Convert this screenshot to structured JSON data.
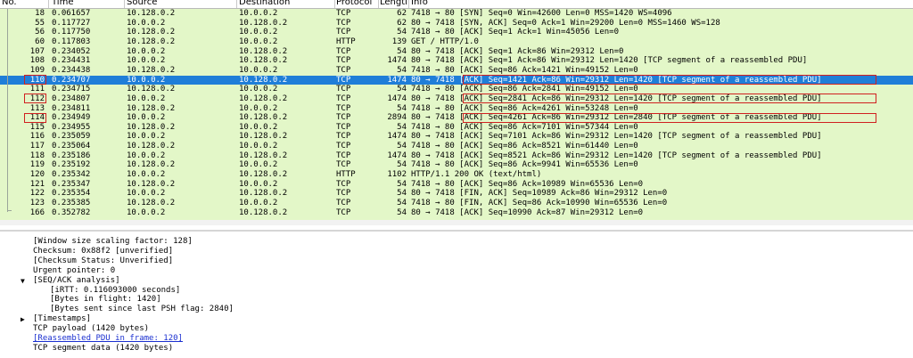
{
  "columns": [
    "No.",
    "Time",
    "Source",
    "Destination",
    "Protocol",
    "Lengtl",
    "Info"
  ],
  "packets": [
    {
      "no": "18",
      "time": "0.061657",
      "src": "10.128.0.2",
      "dst": "10.0.0.2",
      "proto": "TCP",
      "len": "62",
      "info": "7418 → 80 [SYN] Seq=0 Win=42600 Len=0 MSS=1420 WS=4096"
    },
    {
      "no": "55",
      "time": "0.117727",
      "src": "10.0.0.2",
      "dst": "10.128.0.2",
      "proto": "TCP",
      "len": "62",
      "info": "80 → 7418 [SYN, ACK] Seq=0 Ack=1 Win=29200 Len=0 MSS=1460 WS=128"
    },
    {
      "no": "56",
      "time": "0.117750",
      "src": "10.128.0.2",
      "dst": "10.0.0.2",
      "proto": "TCP",
      "len": "54",
      "info": "7418 → 80 [ACK] Seq=1 Ack=1 Win=45056 Len=0"
    },
    {
      "no": "60",
      "time": "0.117803",
      "src": "10.128.0.2",
      "dst": "10.0.0.2",
      "proto": "HTTP",
      "len": "139",
      "info": "GET / HTTP/1.0"
    },
    {
      "no": "107",
      "time": "0.234052",
      "src": "10.0.0.2",
      "dst": "10.128.0.2",
      "proto": "TCP",
      "len": "54",
      "info": "80 → 7418 [ACK] Seq=1 Ack=86 Win=29312 Len=0"
    },
    {
      "no": "108",
      "time": "0.234431",
      "src": "10.0.0.2",
      "dst": "10.128.0.2",
      "proto": "TCP",
      "len": "1474",
      "info": "80 → 7418 [ACK] Seq=1 Ack=86 Win=29312 Len=1420 [TCP segment of a reassembled PDU]"
    },
    {
      "no": "109",
      "time": "0.234438",
      "src": "10.128.0.2",
      "dst": "10.0.0.2",
      "proto": "TCP",
      "len": "54",
      "info": "7418 → 80 [ACK] Seq=86 Ack=1421 Win=49152 Len=0"
    },
    {
      "no": "110",
      "time": "0.234707",
      "src": "10.0.0.2",
      "dst": "10.128.0.2",
      "proto": "TCP",
      "len": "1474",
      "info": "80 → 7418 [ACK] Seq=1421 Ack=86 Win=29312 Len=1420 [TCP segment of a reassembled PDU]"
    },
    {
      "no": "111",
      "time": "0.234715",
      "src": "10.128.0.2",
      "dst": "10.0.0.2",
      "proto": "TCP",
      "len": "54",
      "info": "7418 → 80 [ACK] Seq=86 Ack=2841 Win=49152 Len=0"
    },
    {
      "no": "112",
      "time": "0.234807",
      "src": "10.0.0.2",
      "dst": "10.128.0.2",
      "proto": "TCP",
      "len": "1474",
      "info": "80 → 7418 [ACK] Seq=2841 Ack=86 Win=29312 Len=1420 [TCP segment of a reassembled PDU]"
    },
    {
      "no": "113",
      "time": "0.234811",
      "src": "10.128.0.2",
      "dst": "10.0.0.2",
      "proto": "TCP",
      "len": "54",
      "info": "7418 → 80 [ACK] Seq=86 Ack=4261 Win=53248 Len=0"
    },
    {
      "no": "114",
      "time": "0.234949",
      "src": "10.0.0.2",
      "dst": "10.128.0.2",
      "proto": "TCP",
      "len": "2894",
      "info": "80 → 7418 [ACK] Seq=4261 Ack=86 Win=29312 Len=2840 [TCP segment of a reassembled PDU]"
    },
    {
      "no": "115",
      "time": "0.234955",
      "src": "10.128.0.2",
      "dst": "10.0.0.2",
      "proto": "TCP",
      "len": "54",
      "info": "7418 → 80 [ACK] Seq=86 Ack=7101 Win=57344 Len=0"
    },
    {
      "no": "116",
      "time": "0.235059",
      "src": "10.0.0.2",
      "dst": "10.128.0.2",
      "proto": "TCP",
      "len": "1474",
      "info": "80 → 7418 [ACK] Seq=7101 Ack=86 Win=29312 Len=1420 [TCP segment of a reassembled PDU]"
    },
    {
      "no": "117",
      "time": "0.235064",
      "src": "10.128.0.2",
      "dst": "10.0.0.2",
      "proto": "TCP",
      "len": "54",
      "info": "7418 → 80 [ACK] Seq=86 Ack=8521 Win=61440 Len=0"
    },
    {
      "no": "118",
      "time": "0.235186",
      "src": "10.0.0.2",
      "dst": "10.128.0.2",
      "proto": "TCP",
      "len": "1474",
      "info": "80 → 7418 [ACK] Seq=8521 Ack=86 Win=29312 Len=1420 [TCP segment of a reassembled PDU]"
    },
    {
      "no": "119",
      "time": "0.235192",
      "src": "10.128.0.2",
      "dst": "10.0.0.2",
      "proto": "TCP",
      "len": "54",
      "info": "7418 → 80 [ACK] Seq=86 Ack=9941 Win=65536 Len=0"
    },
    {
      "no": "120",
      "time": "0.235342",
      "src": "10.0.0.2",
      "dst": "10.128.0.2",
      "proto": "HTTP",
      "len": "1102",
      "info": "HTTP/1.1 200 OK  (text/html)"
    },
    {
      "no": "121",
      "time": "0.235347",
      "src": "10.128.0.2",
      "dst": "10.0.0.2",
      "proto": "TCP",
      "len": "54",
      "info": "7418 → 80 [ACK] Seq=86 Ack=10989 Win=65536 Len=0"
    },
    {
      "no": "122",
      "time": "0.235354",
      "src": "10.0.0.2",
      "dst": "10.128.0.2",
      "proto": "TCP",
      "len": "54",
      "info": "80 → 7418 [FIN, ACK] Seq=10989 Ack=86 Win=29312 Len=0"
    },
    {
      "no": "123",
      "time": "0.235385",
      "src": "10.128.0.2",
      "dst": "10.0.0.2",
      "proto": "TCP",
      "len": "54",
      "info": "7418 → 80 [FIN, ACK] Seq=86 Ack=10990 Win=65536 Len=0"
    },
    {
      "no": "166",
      "time": "0.352782",
      "src": "10.0.0.2",
      "dst": "10.128.0.2",
      "proto": "TCP",
      "len": "54",
      "info": "80 → 7418 [ACK] Seq=10990 Ack=87 Win=29312 Len=0"
    }
  ],
  "selected_packet": "110",
  "highlighted_packets": [
    "110",
    "112",
    "114"
  ],
  "details": [
    {
      "text": "[Window size scaling factor: 128]",
      "indent": 1
    },
    {
      "text": "Checksum: 0x88f2 [unverified]",
      "indent": 1
    },
    {
      "text": "[Checksum Status: Unverified]",
      "indent": 1
    },
    {
      "text": "Urgent pointer: 0",
      "indent": 1
    },
    {
      "text": "[SEQ/ACK analysis]",
      "indent": 1,
      "expander": "expanded"
    },
    {
      "text": "[iRTT: 0.116093000 seconds]",
      "indent": 2
    },
    {
      "text": "[Bytes in flight: 1420]",
      "indent": 2
    },
    {
      "text": "[Bytes sent since last PSH flag: 2840]",
      "indent": 2
    },
    {
      "text": "[Timestamps]",
      "indent": 1,
      "expander": "collapsed"
    },
    {
      "text": "TCP payload (1420 bytes)",
      "indent": 1
    },
    {
      "text": "[Reassembled PDU in frame: 120]",
      "indent": 1,
      "link": true
    },
    {
      "text": "TCP segment data (1420 bytes)",
      "indent": 1
    }
  ],
  "colors": {
    "row_bg": "#e3f7c8",
    "selected_bg": "#1f7ed8",
    "highlight_box": "#d02020",
    "link": "#1a2fd0"
  }
}
